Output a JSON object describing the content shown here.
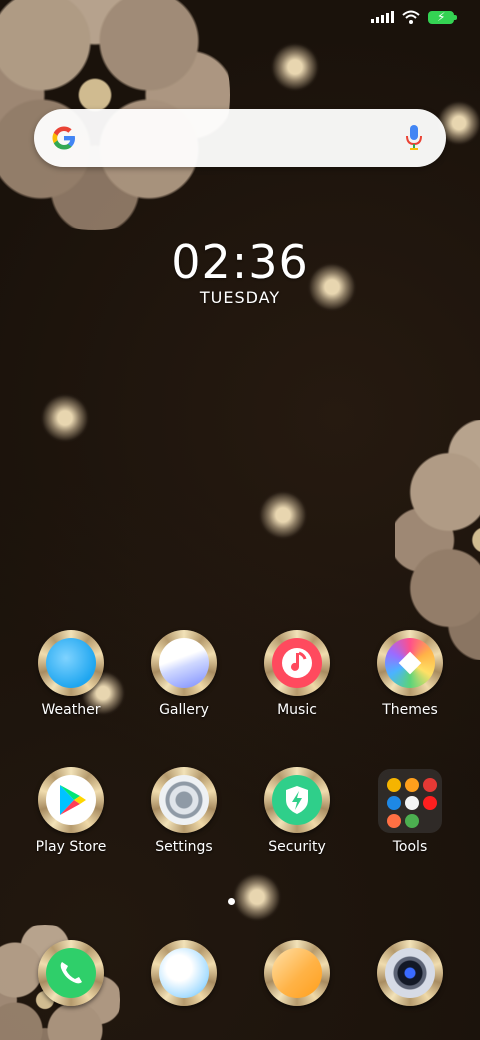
{
  "status_bar": {
    "signal_icon": "cellular-signal-icon",
    "wifi_icon": "wifi-icon",
    "battery_icon": "battery-charging-icon",
    "battery_color": "#34d353"
  },
  "search": {
    "logo": "google-g-icon",
    "mic": "microphone-icon"
  },
  "clock": {
    "time": "02:36",
    "day": "TUESDAY"
  },
  "apps": [
    {
      "label": "Weather",
      "icon": "weather-icon"
    },
    {
      "label": "Gallery",
      "icon": "gallery-icon"
    },
    {
      "label": "Music",
      "icon": "music-icon"
    },
    {
      "label": "Themes",
      "icon": "themes-icon"
    },
    {
      "label": "Play Store",
      "icon": "play-store-icon"
    },
    {
      "label": "Settings",
      "icon": "settings-icon"
    },
    {
      "label": "Security",
      "icon": "security-icon"
    },
    {
      "label": "Tools",
      "icon": "tools-folder-icon"
    }
  ],
  "dock": [
    {
      "icon": "phone-icon"
    },
    {
      "icon": "messages-icon"
    },
    {
      "icon": "notes-icon"
    },
    {
      "icon": "camera-icon"
    }
  ],
  "pager": {
    "current_page": 1
  }
}
